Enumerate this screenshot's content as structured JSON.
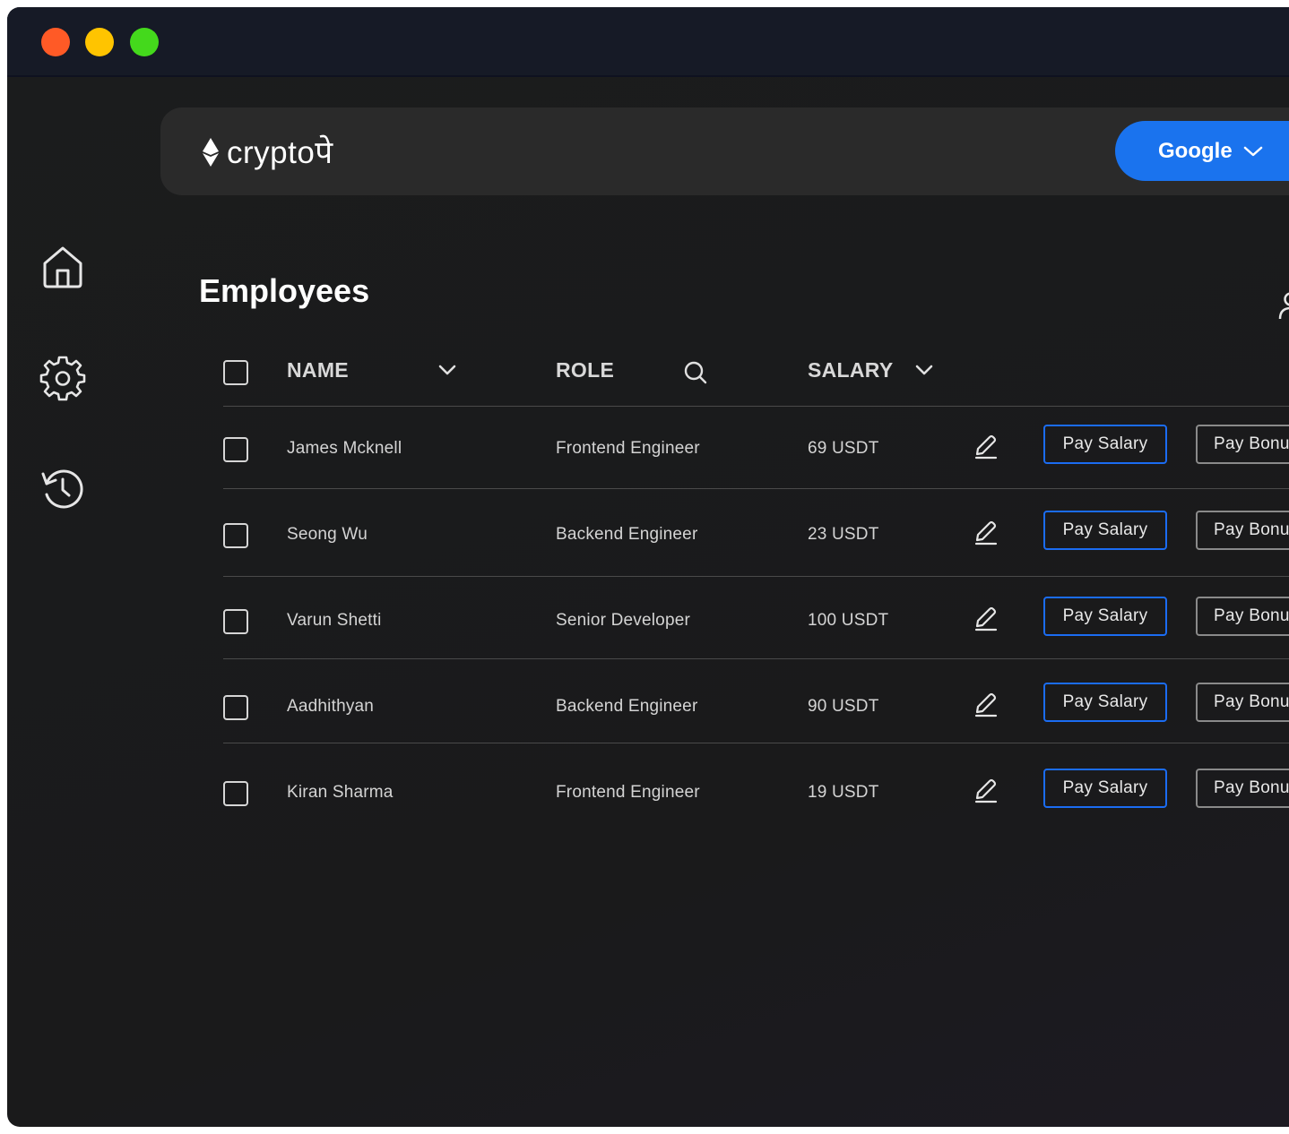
{
  "app": {
    "logo_text": "cryptoपे"
  },
  "header": {
    "account_label": "Google"
  },
  "sidebar": {
    "items": [
      {
        "icon": "home-icon"
      },
      {
        "icon": "gear-icon"
      },
      {
        "icon": "history-icon"
      }
    ]
  },
  "page": {
    "title": "Employees"
  },
  "table": {
    "columns": {
      "name": "NAME",
      "role": "ROLE",
      "salary": "SALARY"
    },
    "rows": [
      {
        "name": "James Mcknell",
        "role": "Frontend Engineer",
        "salary": "69 USDT",
        "pay_salary": "Pay Salary",
        "pay_bonus": "Pay Bonus"
      },
      {
        "name": "Seong Wu",
        "role": "Backend Engineer",
        "salary": "23 USDT",
        "pay_salary": "Pay Salary",
        "pay_bonus": "Pay Bonus"
      },
      {
        "name": "Varun Shetti",
        "role": "Senior Developer",
        "salary": "100 USDT",
        "pay_salary": "Pay Salary",
        "pay_bonus": "Pay Bonus"
      },
      {
        "name": "Aadhithyan",
        "role": "Backend Engineer",
        "salary": "90 USDT",
        "pay_salary": "Pay Salary",
        "pay_bonus": "Pay Bonus"
      },
      {
        "name": "Kiran Sharma",
        "role": "Frontend Engineer",
        "salary": "19 USDT",
        "pay_salary": "Pay Salary",
        "pay_bonus": "Pay Bonus"
      }
    ]
  },
  "colors": {
    "accent": "#1a73ee",
    "window_close": "#ff5a26",
    "window_minimize": "#ffc400",
    "window_maximize": "#44d91c"
  }
}
